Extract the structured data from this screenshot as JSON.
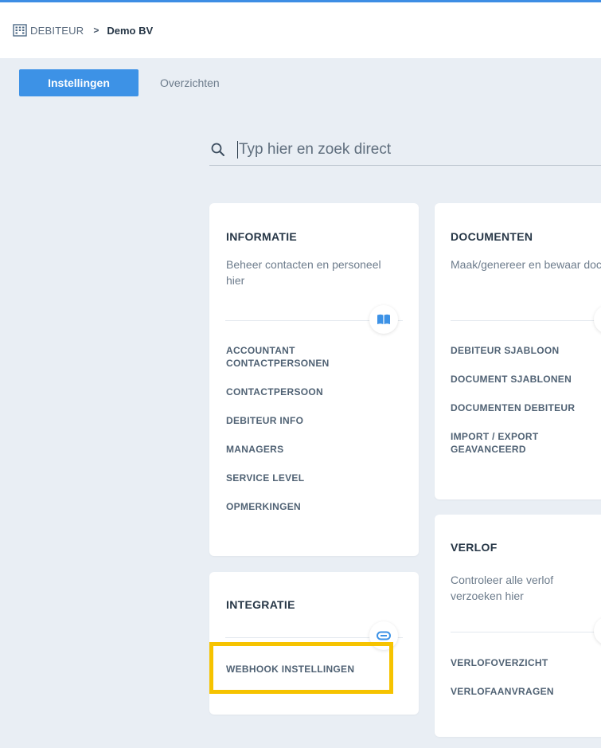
{
  "breadcrumb": {
    "root": "DEBITEUR",
    "current": "Demo BV"
  },
  "tabs": [
    {
      "label": "Instellingen",
      "active": true
    },
    {
      "label": "Overzichten",
      "active": false
    }
  ],
  "search": {
    "placeholder": "Typ hier en zoek direct",
    "value": ""
  },
  "cards": {
    "informatie": {
      "title": "INFORMATIE",
      "description": "Beheer contacten en personeel hier",
      "icon": "book-icon",
      "links": [
        "ACCOUNTANT CONTACTPERSONEN",
        "CONTACTPERSOON",
        "DEBITEUR INFO",
        "MANAGERS",
        "SERVICE LEVEL",
        "OPMERKINGEN"
      ]
    },
    "documenten": {
      "title": "DOCUMENTEN",
      "description": "Maak/genereer en bewaar documenten",
      "links": [
        "DEBITEUR SJABLOON",
        "DOCUMENT SJABLONEN",
        "DOCUMENTEN DEBITEUR",
        "IMPORT / EXPORT GEAVANCEERD"
      ]
    },
    "integratie": {
      "title": "INTEGRATIE",
      "description": "",
      "icon": "link-icon",
      "links": [
        "WEBHOOK INSTELLINGEN"
      ]
    },
    "verlof": {
      "title": "VERLOF",
      "description": "Controleer alle verlof verzoeken hier",
      "links": [
        "VERLOFOVERZICHT",
        "VERLOFAANVRAGEN"
      ]
    }
  },
  "colors": {
    "accent": "#3d92e6",
    "highlight": "#f6c300",
    "background": "#e9eef4"
  }
}
